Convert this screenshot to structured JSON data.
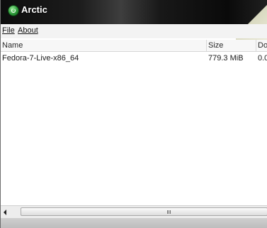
{
  "window": {
    "title": "Arctic"
  },
  "menu": {
    "file_label": "File",
    "about_label": "About"
  },
  "table": {
    "columns": [
      "Name",
      "Size",
      "Do"
    ],
    "rows": [
      {
        "name": "Fedora-7-Live-x86_64",
        "size": "779.3 MiB",
        "done": "0.0"
      }
    ]
  },
  "scrollbar": {
    "grip": "III"
  },
  "colors": {
    "titlebar": "#111111",
    "accent_icon": "#2d9a3a"
  },
  "icons": [
    "arctic-app-icon",
    "scroll-left-arrow-icon"
  ]
}
